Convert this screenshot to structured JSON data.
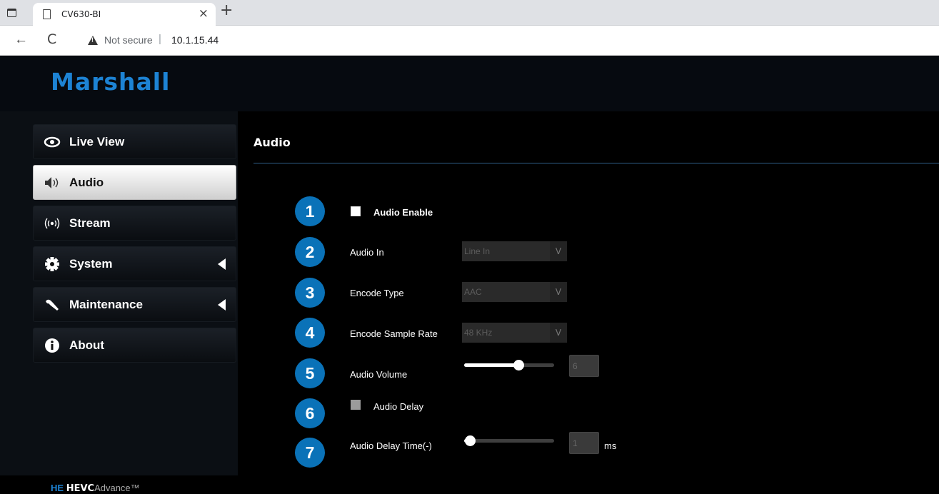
{
  "browser": {
    "tab_title": "CV630-BI",
    "tab_close": "×",
    "new_tab": "+",
    "back": "←",
    "reload": "C",
    "security": "Not secure",
    "separator": "|",
    "url": "10.1.15.44"
  },
  "header": {
    "logo": "Marshall"
  },
  "sidebar": {
    "items": [
      {
        "label": "Live View",
        "icon": "eye-icon",
        "active": false,
        "arrow": false
      },
      {
        "label": "Audio",
        "icon": "speaker-icon",
        "active": true,
        "arrow": false
      },
      {
        "label": "Stream",
        "icon": "broadcast-icon",
        "active": false,
        "arrow": false
      },
      {
        "label": "System",
        "icon": "gear-icon",
        "active": false,
        "arrow": true
      },
      {
        "label": "Maintenance",
        "icon": "wrench-icon",
        "active": false,
        "arrow": true
      },
      {
        "label": "About",
        "icon": "info-icon",
        "active": false,
        "arrow": false
      }
    ],
    "footer_logo": {
      "prefix": "HEVC",
      "suffix": "Advance",
      "tm": "™",
      "mark": "HE"
    }
  },
  "content": {
    "title": "Audio",
    "rows": [
      {
        "num": "1",
        "label": "Audio Enable"
      },
      {
        "num": "2",
        "label": "Audio In",
        "value": "Line In"
      },
      {
        "num": "3",
        "label": "Encode Type",
        "value": "AAC"
      },
      {
        "num": "4",
        "label": "Encode Sample Rate",
        "value": "48 KHz"
      },
      {
        "num": "5",
        "label": "Audio Volume",
        "value": "6",
        "level": 0.6
      },
      {
        "num": "6",
        "label": "Audio Delay"
      },
      {
        "num": "7",
        "label": "Audio Delay Time(-)",
        "value": "1",
        "unit": "ms",
        "level": 0.06
      }
    ],
    "select_arrow": "V"
  },
  "colors": {
    "accent": "#1d83d4",
    "badge": "#0a72b8",
    "background": "#000000"
  }
}
